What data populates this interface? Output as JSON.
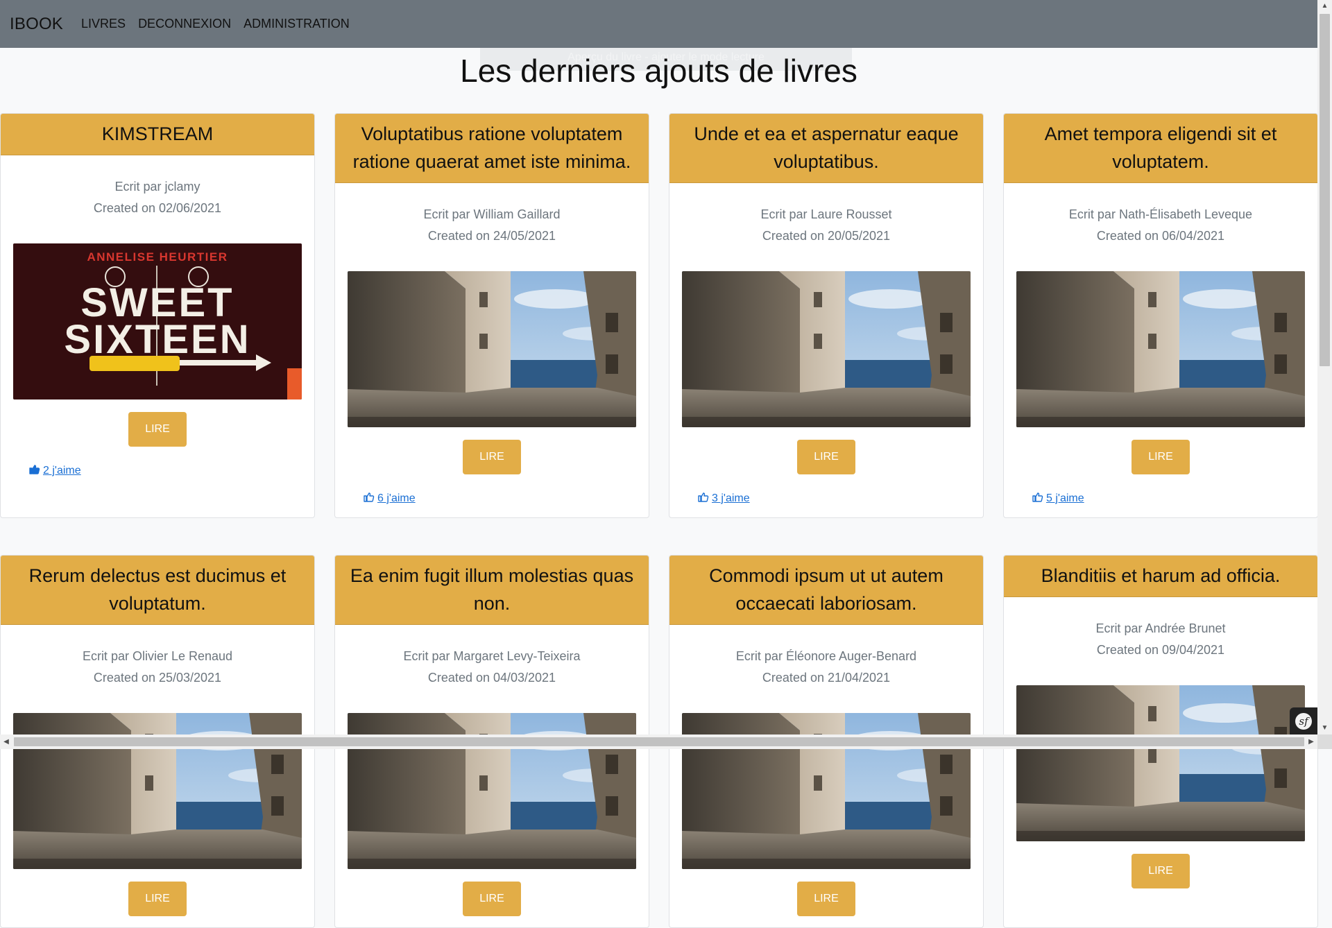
{
  "nav": {
    "brand": "IBOOK",
    "links": [
      "LIVRES",
      "DECONNEXION",
      "ADMINISTRATION"
    ]
  },
  "ghost_text": "Aperçu du livre - ajouter le mode lecture",
  "page_title": "Les derniers ajouts de livres",
  "read_label": "LIRE",
  "colors": {
    "accent": "#e2ad47",
    "navbar": "#6c757d",
    "link": "#1a6fd4"
  },
  "books": [
    {
      "title": "KIMSTREAM",
      "author": "Ecrit par jclamy",
      "created": "Created on 02/06/2021",
      "likes": "2 j'aime",
      "liked": true,
      "cover": "sweet-sixteen-cover"
    },
    {
      "title": "Voluptatibus ratione voluptatem ratione quaerat amet iste minima.",
      "author": "Ecrit par William Gaillard",
      "created": "Created on 24/05/2021",
      "likes": "6 j'aime",
      "liked": false,
      "cover": "alley-sea-photo"
    },
    {
      "title": "Unde et ea et aspernatur eaque voluptatibus.",
      "author": "Ecrit par Laure Rousset",
      "created": "Created on 20/05/2021",
      "likes": "3 j'aime",
      "liked": false,
      "cover": "alley-sea-photo"
    },
    {
      "title": "Amet tempora eligendi sit et voluptatem.",
      "author": "Ecrit par Nath-Élisabeth Leveque",
      "created": "Created on 06/04/2021",
      "likes": "5 j'aime",
      "liked": false,
      "cover": "alley-sea-photo"
    },
    {
      "title": "Rerum delectus est ducimus et voluptatum.",
      "author": "Ecrit par Olivier Le Renaud",
      "created": "Created on 25/03/2021",
      "cover": "alley-sea-photo"
    },
    {
      "title": "Ea enim fugit illum molestias quas non.",
      "author": "Ecrit par Margaret Levy-Teixeira",
      "created": "Created on 04/03/2021",
      "cover": "alley-sea-photo"
    },
    {
      "title": "Commodi ipsum ut ut autem occaecati laboriosam.",
      "author": "Ecrit par Éléonore Auger-Benard",
      "created": "Created on 21/04/2021",
      "cover": "alley-sea-photo"
    },
    {
      "title": "Blanditiis et harum ad officia.",
      "author": "Ecrit par Andrée Brunet",
      "created": "Created on 09/04/2021",
      "cover": "alley-sea-photo"
    }
  ],
  "cover_text": {
    "author_banner": "ANNELISE HEURTIER",
    "title_line1": "SWEET",
    "title_line2": "SIXTEEN"
  }
}
